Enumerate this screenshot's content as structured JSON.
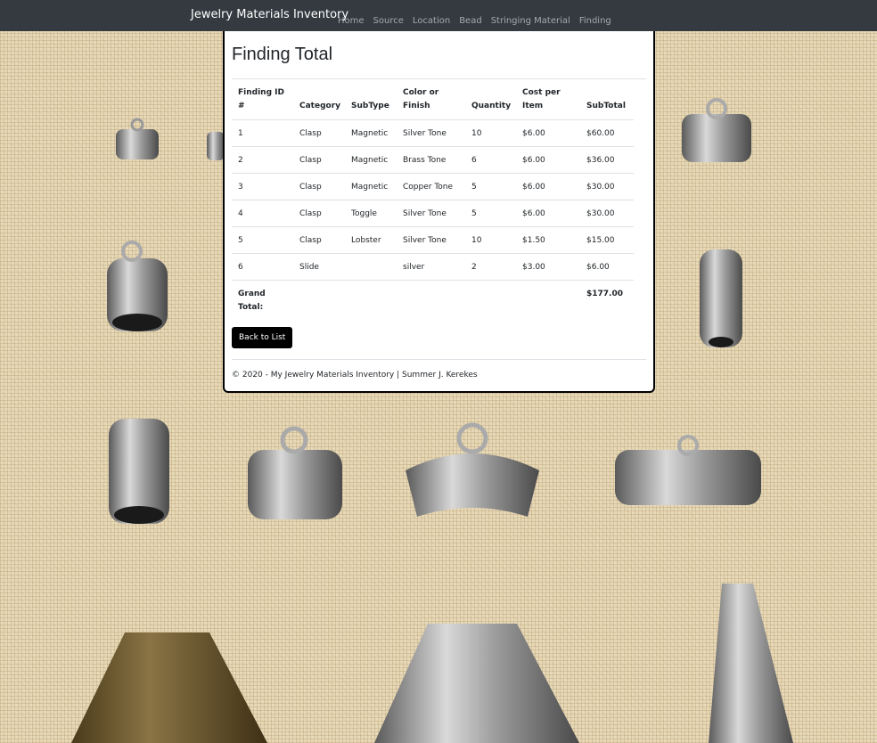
{
  "navbar": {
    "brand": "Jewelry Materials Inventory",
    "links": [
      "Home",
      "Source",
      "Location",
      "Bead",
      "Stringing Material",
      "Finding"
    ]
  },
  "page": {
    "title": "Finding Total"
  },
  "table": {
    "headers": [
      "Finding ID #",
      "Category",
      "SubType",
      "Color or Finish",
      "Quantity",
      "Cost per Item",
      "SubTotal"
    ],
    "rows": [
      [
        "1",
        "Clasp",
        "Magnetic",
        "Silver Tone",
        "10",
        "$6.00",
        "$60.00"
      ],
      [
        "2",
        "Clasp",
        "Magnetic",
        "Brass Tone",
        "6",
        "$6.00",
        "$36.00"
      ],
      [
        "3",
        "Clasp",
        "Magnetic",
        "Copper Tone",
        "5",
        "$6.00",
        "$30.00"
      ],
      [
        "4",
        "Clasp",
        "Toggle",
        "Silver Tone",
        "5",
        "$6.00",
        "$30.00"
      ],
      [
        "5",
        "Clasp",
        "Lobster",
        "Silver Tone",
        "10",
        "$1.50",
        "$15.00"
      ],
      [
        "6",
        "Slide",
        "",
        "silver",
        "2",
        "$3.00",
        "$6.00"
      ]
    ],
    "total_label": "Grand Total:",
    "total_value": "$177.00"
  },
  "actions": {
    "back_label": "Back to List"
  },
  "footer": {
    "text": "© 2020 - My Jewelry Materials Inventory | Summer J. Kerekes"
  },
  "colors": {
    "navbar": "#343a40",
    "background": "#e6d7b4",
    "button": "#000000"
  }
}
